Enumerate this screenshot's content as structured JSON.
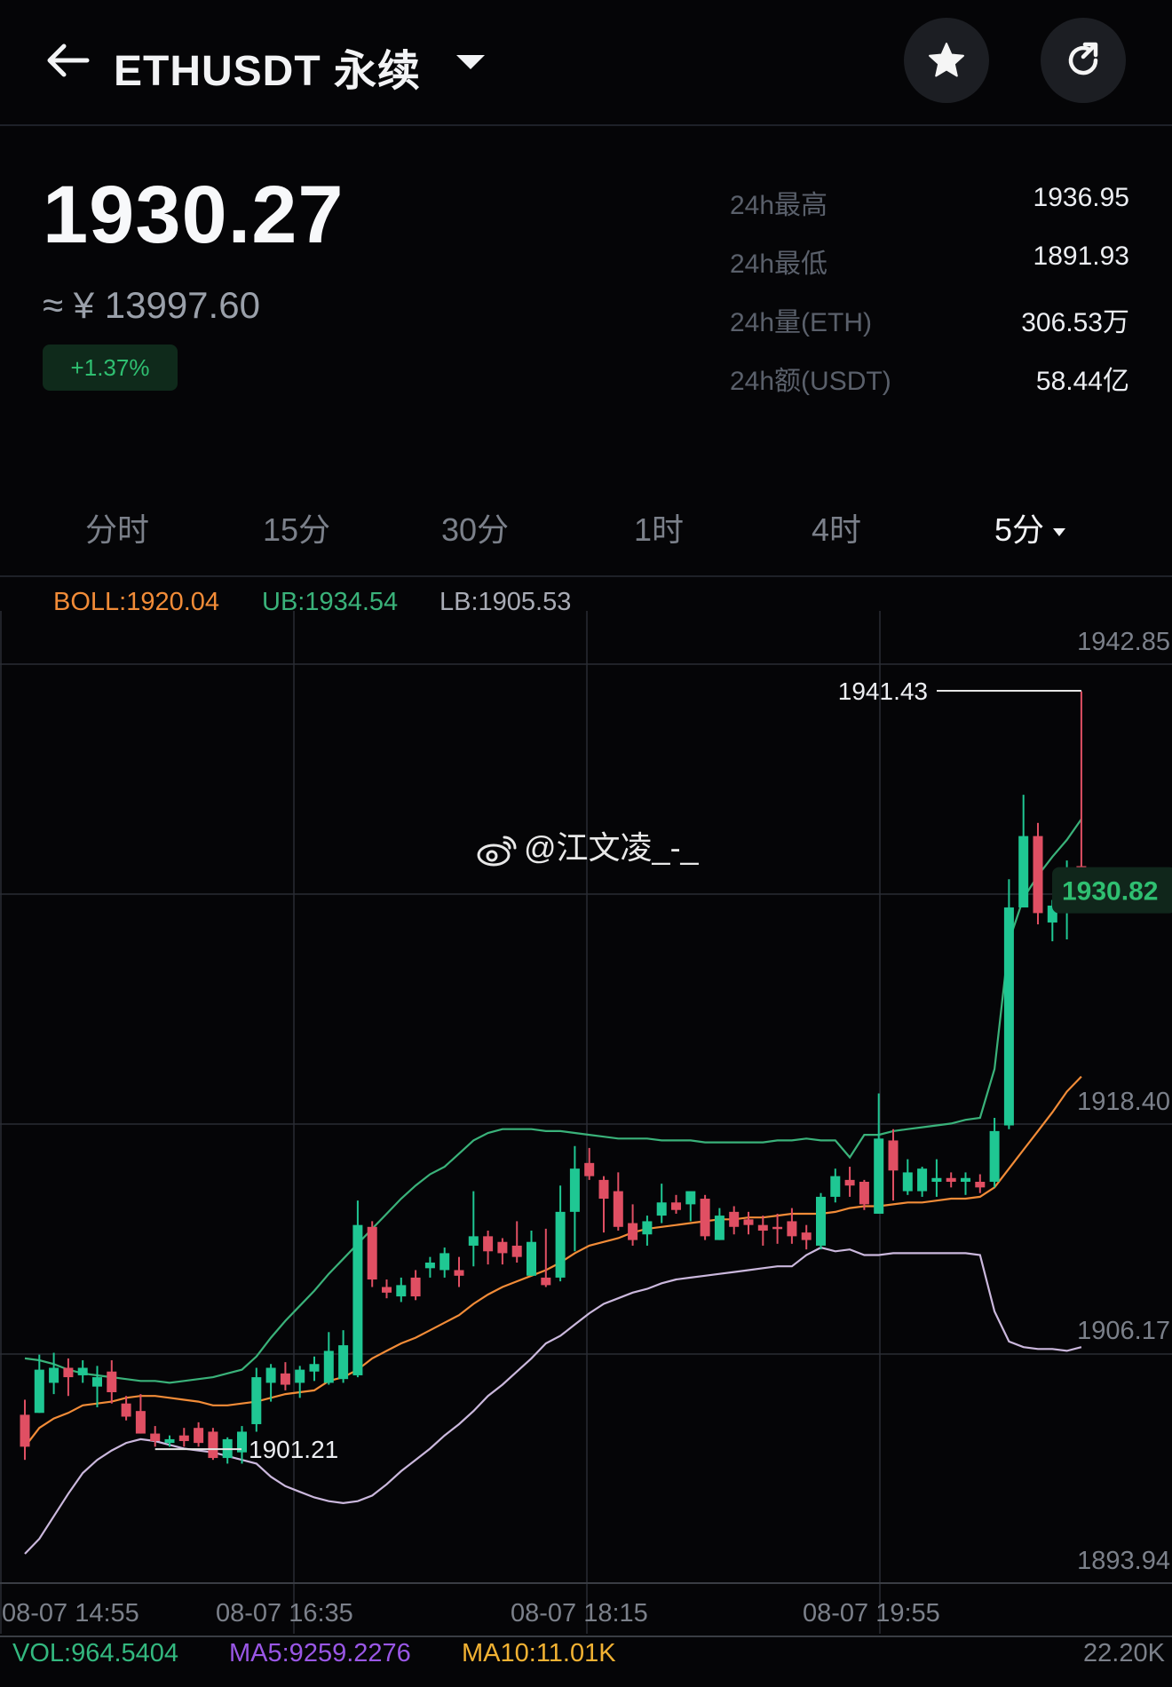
{
  "header": {
    "title": "ETHUSDT 永续",
    "back_icon": "arrow-left-icon",
    "dropdown_icon": "caret-down-icon",
    "favorite_icon": "star-icon",
    "share_icon": "share-icon"
  },
  "ticker": {
    "price": "1930.27",
    "price_cny": "≈ ¥ 13997.60",
    "change": "+1.37%",
    "stats": [
      {
        "label": "24h最高",
        "value": "1936.95"
      },
      {
        "label": "24h最低",
        "value": "1891.93"
      },
      {
        "label": "24h量(ETH)",
        "value": "306.53万"
      },
      {
        "label": "24h额(USDT)",
        "value": "58.44亿"
      }
    ]
  },
  "tabs": [
    {
      "label": "分时"
    },
    {
      "label": "15分"
    },
    {
      "label": "30分"
    },
    {
      "label": "1时"
    },
    {
      "label": "4时"
    },
    {
      "label": "5分",
      "active": true
    }
  ],
  "indicators": {
    "boll": "BOLL:1920.04",
    "ub": "UB:1934.54",
    "lb": "LB:1905.53"
  },
  "watermark": "@江文凌_-_",
  "volume": {
    "vol": "VOL:964.5404",
    "ma5": "MA5:9259.2276",
    "ma10": "MA10:11.01K",
    "axis_max": "22.20K"
  },
  "colors": {
    "up": "#1fc793",
    "down": "#e04f63",
    "boll": "#f28c38",
    "ub": "#3ab27a",
    "lb": "#cbb8dd",
    "badge_bg": "#0f2a1b",
    "badge_text": "#2fbf71"
  },
  "chart_data": {
    "type": "candlestick",
    "y_ticks": [
      "1942.85",
      "1918.40",
      "1906.17",
      "1893.94"
    ],
    "x_ticks": [
      "08-07 14:55",
      "08-07 16:35",
      "08-07 18:15",
      "08-07 19:55"
    ],
    "ylim": [
      1893.94,
      1942.85
    ],
    "high_label": "1941.43",
    "low_label": "1901.21",
    "current_price": "1930.82",
    "candles": [
      {
        "o": 1902.9,
        "h": 1903.7,
        "c": 1901.2,
        "l": 1900.5
      },
      {
        "o": 1903.0,
        "h": 1906.1,
        "c": 1905.3,
        "l": 1903.0
      },
      {
        "o": 1904.6,
        "h": 1906.2,
        "c": 1905.4,
        "l": 1904.0
      },
      {
        "o": 1905.4,
        "h": 1905.9,
        "c": 1904.9,
        "l": 1903.9
      },
      {
        "o": 1905.0,
        "h": 1905.8,
        "c": 1905.4,
        "l": 1904.6
      },
      {
        "o": 1904.4,
        "h": 1905.5,
        "c": 1904.9,
        "l": 1903.3
      },
      {
        "o": 1905.2,
        "h": 1905.8,
        "c": 1904.1,
        "l": 1903.5
      },
      {
        "o": 1903.5,
        "h": 1903.9,
        "c": 1902.8,
        "l": 1902.6
      },
      {
        "o": 1903.1,
        "h": 1904.0,
        "c": 1901.9,
        "l": 1901.9
      },
      {
        "o": 1901.9,
        "h": 1902.3,
        "c": 1901.5,
        "l": 1901.2
      },
      {
        "o": 1901.4,
        "h": 1901.8,
        "c": 1901.6,
        "l": 1901.2
      },
      {
        "o": 1901.8,
        "h": 1902.2,
        "c": 1901.5,
        "l": 1901.2
      },
      {
        "o": 1902.2,
        "h": 1902.5,
        "c": 1901.4,
        "l": 1901.2
      },
      {
        "o": 1902.0,
        "h": 1902.2,
        "c": 1900.6,
        "l": 1900.5
      },
      {
        "o": 1900.6,
        "h": 1901.7,
        "c": 1901.6,
        "l": 1900.3
      },
      {
        "o": 1900.9,
        "h": 1902.3,
        "c": 1902.0,
        "l": 1900.3
      },
      {
        "o": 1902.4,
        "h": 1905.4,
        "c": 1904.9,
        "l": 1902.0
      },
      {
        "o": 1904.6,
        "h": 1905.6,
        "c": 1905.4,
        "l": 1903.6
      },
      {
        "o": 1905.1,
        "h": 1905.7,
        "c": 1904.5,
        "l": 1904.2
      },
      {
        "o": 1904.6,
        "h": 1905.5,
        "c": 1905.3,
        "l": 1903.8
      },
      {
        "o": 1905.2,
        "h": 1906.0,
        "c": 1905.6,
        "l": 1904.7
      },
      {
        "o": 1904.6,
        "h": 1907.3,
        "c": 1906.3,
        "l": 1904.5
      },
      {
        "o": 1904.8,
        "h": 1907.4,
        "c": 1906.6,
        "l": 1904.6
      },
      {
        "o": 1905.0,
        "h": 1914.3,
        "c": 1913.0,
        "l": 1904.9
      },
      {
        "o": 1912.9,
        "h": 1913.2,
        "c": 1910.1,
        "l": 1909.7
      },
      {
        "o": 1909.7,
        "h": 1910.1,
        "c": 1909.4,
        "l": 1909.1
      },
      {
        "o": 1909.2,
        "h": 1910.2,
        "c": 1909.8,
        "l": 1908.9
      },
      {
        "o": 1910.2,
        "h": 1910.6,
        "c": 1909.2,
        "l": 1909.0
      },
      {
        "o": 1910.7,
        "h": 1911.3,
        "c": 1911.0,
        "l": 1910.2
      },
      {
        "o": 1910.6,
        "h": 1911.8,
        "c": 1911.5,
        "l": 1910.2
      },
      {
        "o": 1910.6,
        "h": 1911.3,
        "c": 1910.3,
        "l": 1909.7
      },
      {
        "o": 1911.9,
        "h": 1914.8,
        "c": 1912.4,
        "l": 1910.8
      },
      {
        "o": 1912.4,
        "h": 1912.7,
        "c": 1911.6,
        "l": 1910.9
      },
      {
        "o": 1912.1,
        "h": 1912.3,
        "c": 1911.5,
        "l": 1910.9
      },
      {
        "o": 1911.9,
        "h": 1913.2,
        "c": 1911.3,
        "l": 1911.0
      },
      {
        "o": 1910.3,
        "h": 1912.7,
        "c": 1912.1,
        "l": 1910.3
      },
      {
        "o": 1910.2,
        "h": 1912.8,
        "c": 1909.8,
        "l": 1909.7
      },
      {
        "o": 1910.2,
        "h": 1915.1,
        "c": 1913.7,
        "l": 1910.0
      },
      {
        "o": 1913.7,
        "h": 1917.2,
        "c": 1916.0,
        "l": 1911.6
      },
      {
        "o": 1916.3,
        "h": 1917.1,
        "c": 1915.6,
        "l": 1915.4
      },
      {
        "o": 1915.4,
        "h": 1915.6,
        "c": 1914.4,
        "l": 1912.6
      },
      {
        "o": 1914.8,
        "h": 1915.8,
        "c": 1912.9,
        "l": 1912.7
      },
      {
        "o": 1913.1,
        "h": 1914.1,
        "c": 1912.2,
        "l": 1911.9
      },
      {
        "o": 1912.5,
        "h": 1913.5,
        "c": 1913.2,
        "l": 1911.9
      },
      {
        "o": 1913.5,
        "h": 1915.2,
        "c": 1914.2,
        "l": 1913.1
      },
      {
        "o": 1914.2,
        "h": 1914.6,
        "c": 1913.8,
        "l": 1913.6
      },
      {
        "o": 1914.1,
        "h": 1914.4,
        "c": 1914.8,
        "l": 1913.2
      },
      {
        "o": 1914.4,
        "h": 1914.6,
        "c": 1912.4,
        "l": 1912.2
      },
      {
        "o": 1912.2,
        "h": 1913.9,
        "c": 1913.5,
        "l": 1912.2
      },
      {
        "o": 1913.7,
        "h": 1914.0,
        "c": 1912.9,
        "l": 1912.5
      },
      {
        "o": 1913.3,
        "h": 1913.7,
        "c": 1913.0,
        "l": 1912.5
      },
      {
        "o": 1913.0,
        "h": 1913.5,
        "c": 1912.7,
        "l": 1911.9
      },
      {
        "o": 1912.9,
        "h": 1913.6,
        "c": 1912.8,
        "l": 1912.0
      },
      {
        "o": 1913.2,
        "h": 1913.9,
        "c": 1912.4,
        "l": 1912.0
      },
      {
        "o": 1912.6,
        "h": 1913.0,
        "c": 1912.2,
        "l": 1911.7
      },
      {
        "o": 1911.9,
        "h": 1914.7,
        "c": 1914.5,
        "l": 1911.7
      },
      {
        "o": 1914.5,
        "h": 1916.0,
        "c": 1915.6,
        "l": 1914.2
      },
      {
        "o": 1915.4,
        "h": 1916.1,
        "c": 1915.1,
        "l": 1914.5
      },
      {
        "o": 1915.3,
        "h": 1915.4,
        "c": 1914.1,
        "l": 1913.8
      },
      {
        "o": 1913.6,
        "h": 1920.0,
        "c": 1917.6,
        "l": 1913.6
      },
      {
        "o": 1917.5,
        "h": 1918.1,
        "c": 1915.9,
        "l": 1914.3
      },
      {
        "o": 1914.8,
        "h": 1916.5,
        "c": 1915.8,
        "l": 1914.6
      },
      {
        "o": 1914.8,
        "h": 1916.1,
        "c": 1916.0,
        "l": 1914.5
      },
      {
        "o": 1915.3,
        "h": 1916.5,
        "c": 1915.5,
        "l": 1914.5
      },
      {
        "o": 1915.5,
        "h": 1915.8,
        "c": 1915.3,
        "l": 1915.0
      },
      {
        "o": 1915.3,
        "h": 1915.8,
        "c": 1915.5,
        "l": 1914.6
      },
      {
        "o": 1915.3,
        "h": 1915.7,
        "c": 1915.0,
        "l": 1914.7
      },
      {
        "o": 1915.3,
        "h": 1918.7,
        "c": 1918.0,
        "l": 1915.0
      },
      {
        "o": 1918.3,
        "h": 1931.4,
        "c": 1929.9,
        "l": 1918.1
      },
      {
        "o": 1929.9,
        "h": 1935.9,
        "c": 1933.7,
        "l": 1929.9
      },
      {
        "o": 1933.7,
        "h": 1934.4,
        "c": 1929.6,
        "l": 1929.0
      },
      {
        "o": 1929.1,
        "h": 1930.3,
        "c": 1930.0,
        "l": 1928.1
      },
      {
        "o": 1929.6,
        "h": 1932.4,
        "c": 1932.0,
        "l": 1928.2
      },
      {
        "o": 1932.1,
        "h": 1941.4,
        "c": 1930.8,
        "l": 1930.2
      }
    ],
    "boll_mid": [
      1901.2,
      1902.2,
      1902.7,
      1903.0,
      1903.4,
      1903.5,
      1903.6,
      1903.8,
      1903.9,
      1903.9,
      1903.8,
      1903.7,
      1903.6,
      1903.4,
      1903.4,
      1903.5,
      1903.6,
      1903.8,
      1904.0,
      1904.1,
      1904.2,
      1904.7,
      1904.9,
      1905.3,
      1905.9,
      1906.3,
      1906.7,
      1907.0,
      1907.4,
      1907.8,
      1908.2,
      1908.8,
      1909.3,
      1909.7,
      1910.0,
      1910.3,
      1910.6,
      1911.0,
      1911.5,
      1911.9,
      1912.1,
      1912.3,
      1912.6,
      1912.8,
      1912.9,
      1913.0,
      1913.1,
      1913.2,
      1913.3,
      1913.3,
      1913.4,
      1913.4,
      1913.5,
      1913.6,
      1913.6,
      1913.6,
      1913.7,
      1913.9,
      1914.0,
      1914.0,
      1914.1,
      1914.2,
      1914.2,
      1914.3,
      1914.4,
      1914.4,
      1914.5,
      1915.0,
      1916.0,
      1917.0,
      1918.0,
      1919.0,
      1920.1,
      1920.9
    ],
    "boll_upper": [
      1905.9,
      1905.8,
      1905.6,
      1905.3,
      1905.1,
      1905.0,
      1904.9,
      1904.8,
      1904.7,
      1904.7,
      1904.6,
      1904.7,
      1904.8,
      1904.9,
      1905.1,
      1905.3,
      1906.0,
      1907.0,
      1907.9,
      1908.7,
      1909.5,
      1910.4,
      1911.2,
      1912.0,
      1912.8,
      1913.6,
      1914.4,
      1915.1,
      1915.7,
      1916.1,
      1916.8,
      1917.5,
      1917.9,
      1918.1,
      1918.1,
      1918.1,
      1918.0,
      1918.0,
      1917.9,
      1917.8,
      1917.7,
      1917.6,
      1917.6,
      1917.6,
      1917.5,
      1917.5,
      1917.5,
      1917.4,
      1917.4,
      1917.4,
      1917.4,
      1917.4,
      1917.5,
      1917.5,
      1917.6,
      1917.5,
      1917.5,
      1916.6,
      1917.8,
      1917.8,
      1918.0,
      1918.1,
      1918.2,
      1918.3,
      1918.4,
      1918.6,
      1918.7,
      1921.3,
      1928.1,
      1930.4,
      1931.6,
      1932.6,
      1933.5,
      1934.6
    ],
    "boll_lower": [
      1895.5,
      1896.3,
      1897.5,
      1898.7,
      1899.8,
      1900.5,
      1901.0,
      1901.4,
      1901.6,
      1901.5,
      1901.3,
      1901.1,
      1901.0,
      1900.9,
      1900.7,
      1900.5,
      1900.3,
      1899.6,
      1899.1,
      1898.8,
      1898.5,
      1898.3,
      1898.2,
      1898.3,
      1898.6,
      1899.2,
      1899.9,
      1900.5,
      1901.1,
      1901.8,
      1902.4,
      1903.1,
      1903.9,
      1904.5,
      1905.2,
      1905.9,
      1906.7,
      1907.1,
      1907.7,
      1908.3,
      1908.8,
      1909.1,
      1909.4,
      1909.6,
      1909.9,
      1910.1,
      1910.2,
      1910.3,
      1910.4,
      1910.5,
      1910.6,
      1910.7,
      1910.8,
      1910.8,
      1911.4,
      1911.8,
      1911.6,
      1911.7,
      1911.4,
      1911.4,
      1911.5,
      1911.5,
      1911.5,
      1911.5,
      1911.5,
      1911.5,
      1911.4,
      1908.4,
      1906.8,
      1906.5,
      1906.4,
      1906.4,
      1906.3,
      1906.5
    ]
  }
}
